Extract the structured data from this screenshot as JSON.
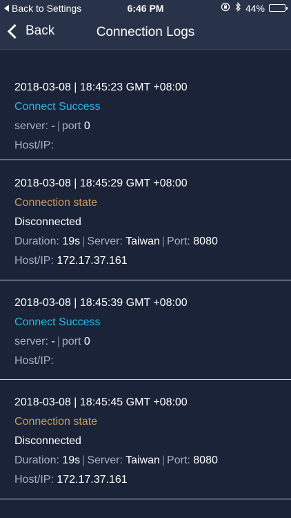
{
  "status_bar": {
    "back_label": "Back to Settings",
    "time": "6:46 PM",
    "battery_percent": "44%",
    "battery_level": 0.44,
    "battery_color": "#f5c518"
  },
  "nav": {
    "back_label": "Back",
    "title": "Connection Logs"
  },
  "logs": [
    {
      "timestamp": "2018-03-08 | 18:45:23 GMT +08:00",
      "event": "Connect Success",
      "server_label": "server:",
      "server_value": "-",
      "port_label": "port",
      "port_value": "0",
      "host_label": "Host/IP:",
      "host_value": ""
    },
    {
      "timestamp": "2018-03-08 | 18:45:29 GMT +08:00",
      "event": "Connection state",
      "state": "Disconnected",
      "duration_label": "Duration:",
      "duration_value": "19s",
      "server_label": "Server:",
      "server_value": "Taiwan",
      "port_label": "Port:",
      "port_value": "8080",
      "host_label": "Host/IP:",
      "host_value": "172.17.37.161"
    },
    {
      "timestamp": "2018-03-08 | 18:45:39 GMT +08:00",
      "event": "Connect Success",
      "server_label": "server:",
      "server_value": "-",
      "port_label": "port",
      "port_value": "0",
      "host_label": "Host/IP:",
      "host_value": ""
    },
    {
      "timestamp": "2018-03-08 | 18:45:45 GMT +08:00",
      "event": "Connection state",
      "state": "Disconnected",
      "duration_label": "Duration:",
      "duration_value": "19s",
      "server_label": "Server:",
      "server_value": "Taiwan",
      "port_label": "Port:",
      "port_value": "8080",
      "host_label": "Host/IP:",
      "host_value": "172.17.37.161"
    }
  ],
  "colors": {
    "background": "#1b2338",
    "nav_background": "#283248",
    "success": "#2cb7e6",
    "state": "#c99a5a"
  }
}
